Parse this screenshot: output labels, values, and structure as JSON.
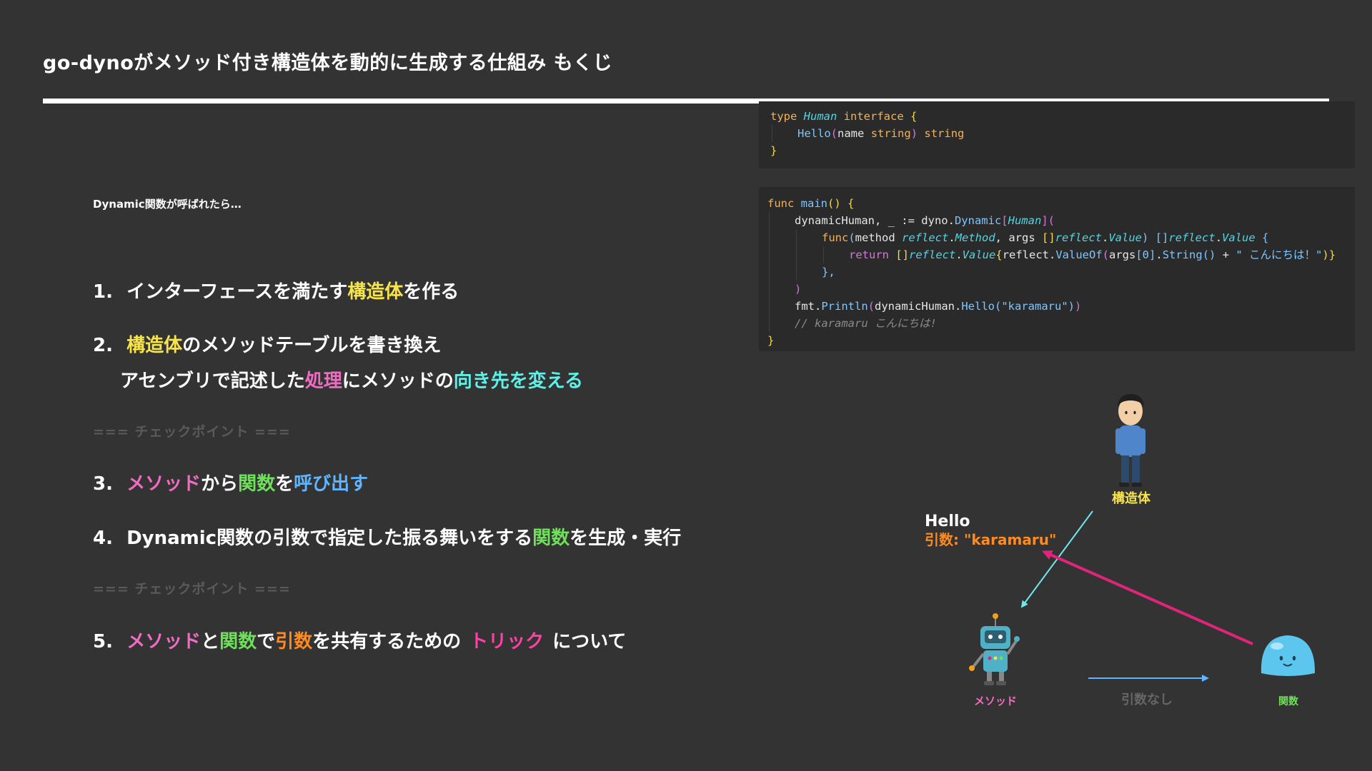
{
  "header": {
    "title": "go-dynoがメソッド付き構造体を動的に生成する仕組み もくじ"
  },
  "intro": "Dynamic関数が呼ばれたら…",
  "list": {
    "item1": {
      "num": "1.",
      "p1": "インターフェースを満たす",
      "p2": "構造体",
      "p3": "を作る"
    },
    "item2": {
      "num": "2.",
      "p1": "構造体",
      "p2": "のメソッドテーブルを書き換え"
    },
    "item2b": {
      "p1": "アセンブリで記述した",
      "p2": "処理",
      "p3": "にメソッドの",
      "p4": "向き先を変える"
    },
    "checkpoint1": "=== チェックポイント ===",
    "item3": {
      "num": "3.",
      "p1": "メソッド",
      "p2": "から",
      "p3": "関数",
      "p4": "を",
      "p5": "呼び出す"
    },
    "item4": {
      "num": "4.",
      "p1": "Dynamic関数の引数で指定した振る舞いをする",
      "p2": "関数",
      "p3": "を生成・実行"
    },
    "checkpoint2": "=== チェックポイント ===",
    "item5": {
      "num": "5.",
      "p1": "メソッド",
      "p2": "と",
      "p3": "関数",
      "p4": "で",
      "p5": "引数",
      "p6": "を共有するための",
      "p7": "トリック",
      "p8": "について"
    }
  },
  "code1": {
    "l1": {
      "a": "type ",
      "b": "Human",
      "c": " interface ",
      "d": "{"
    },
    "l2": {
      "a": "Hello",
      "b": "(",
      "c": "name ",
      "d": "string",
      "e": ")",
      "f": " string"
    },
    "l3": {
      "a": "}"
    }
  },
  "code2": {
    "l1": {
      "a": "func ",
      "b": "main",
      "c": "()",
      "d": " {"
    },
    "l2": {
      "a": "dynamicHuman, _ := dyno.",
      "b": "Dynamic",
      "c": "[",
      "d": "Human",
      "e": "]("
    },
    "l3": {
      "a": "func",
      "b": "(",
      "c": "method ",
      "d": "reflect",
      "e": ".",
      "f": "Method",
      "g": ", args ",
      "h": "[]",
      "i": "reflect",
      "j": ".",
      "k": "Value",
      "l": ")",
      "m": " []",
      "n": "reflect",
      "o": ".",
      "p": "Value",
      "q": " {"
    },
    "l4": {
      "a": "return ",
      "b": "[]",
      "c": "reflect",
      "d": ".",
      "e": "Value",
      "f": "{",
      "g": "reflect.",
      "h": "ValueOf",
      "i": "(",
      "j": "args",
      "k": "[0]",
      "l": ".",
      "m": "String",
      "n": "()",
      "o": " + ",
      "p": "\" こんにちは！\"",
      "q": ")}"
    },
    "l5": {
      "a": "},"
    },
    "l6": {
      "a": ")"
    },
    "l7": {
      "a": "fmt.",
      "b": "Println",
      "c": "(",
      "d": "dynamicHuman.",
      "e": "Hello",
      "f": "(\"karamaru\")",
      "g": ")"
    },
    "l8": {
      "a": "// karamaru こんにちは!"
    },
    "l9": {
      "a": "}"
    }
  },
  "diagram": {
    "struct_label": "構造体",
    "hello": "Hello",
    "arg_label": "引数: \"karamaru\"",
    "method_label": "メソッド",
    "func_label": "関数",
    "no_args": "引数なし"
  },
  "colors": {
    "yellow": "#f7e34a",
    "pink": "#f06bc1",
    "cyan": "#5ff0e6",
    "green": "#6ee05a",
    "orange": "#ff8a1f",
    "magenta": "#ff3fa4",
    "arrow_cyan": "#6fe8ee",
    "arrow_magenta": "#e0247a",
    "arrow_blue": "#5fb5ff"
  }
}
